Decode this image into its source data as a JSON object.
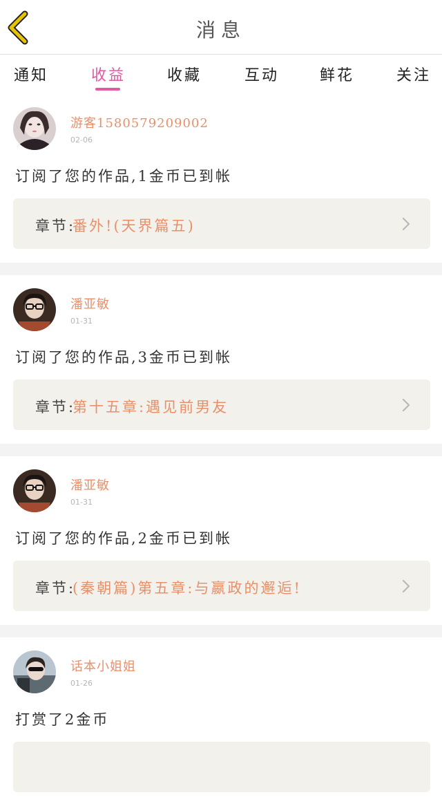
{
  "header": {
    "title": "消息"
  },
  "tabs": [
    {
      "label": "通知",
      "active": false
    },
    {
      "label": "收益",
      "active": true
    },
    {
      "label": "收藏",
      "active": false
    },
    {
      "label": "互动",
      "active": false
    },
    {
      "label": "鲜花",
      "active": false
    },
    {
      "label": "关注",
      "active": false
    }
  ],
  "messages": [
    {
      "user": "游客1580579209002",
      "date": "02-06",
      "text": "订阅了您的作品,1金币已到帐",
      "chapter_prefix": "章节:",
      "chapter_title": "番外!(天界篇五)"
    },
    {
      "user": "潘亚敏",
      "date": "01-31",
      "text": "订阅了您的作品,3金币已到帐",
      "chapter_prefix": "章节:",
      "chapter_title": "第十五章:遇见前男友"
    },
    {
      "user": "潘亚敏",
      "date": "01-31",
      "text": "订阅了您的作品,2金币已到帐",
      "chapter_prefix": "章节:",
      "chapter_title": "(秦朝篇)第五章:与嬴政的邂逅!"
    },
    {
      "user": "话本小姐姐",
      "date": "01-26",
      "text": "打赏了2金币",
      "chapter_prefix": "",
      "chapter_title": ""
    }
  ],
  "colors": {
    "accent": "#e05aa0",
    "name": "#e8906a",
    "back_icon": "#e8c400"
  }
}
